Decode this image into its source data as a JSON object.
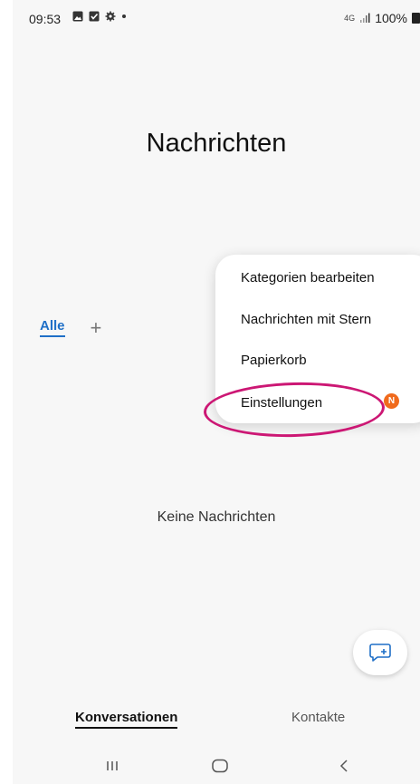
{
  "status_bar": {
    "time": "09:53",
    "network": "4G",
    "battery": "100%",
    "icons": [
      "image-icon",
      "checkbox-icon",
      "gear-icon",
      "dot-icon",
      "signal-icon",
      "battery-icon"
    ]
  },
  "header": {
    "title": "Nachrichten"
  },
  "filters": {
    "all_label": "Alle",
    "add_symbol": "+"
  },
  "empty_state": {
    "text": "Keine Nachrichten"
  },
  "menu": {
    "items": [
      {
        "label": "Kategorien bearbeiten"
      },
      {
        "label": "Nachrichten mit Stern"
      },
      {
        "label": "Papierkorb"
      },
      {
        "label": "Einstellungen"
      }
    ],
    "badge": "N"
  },
  "bottom_tabs": {
    "conversations": "Konversationen",
    "contacts": "Kontakte"
  },
  "colors": {
    "accent": "#1f6fc7",
    "badge": "#f06a1c",
    "highlight": "#cc1774"
  }
}
